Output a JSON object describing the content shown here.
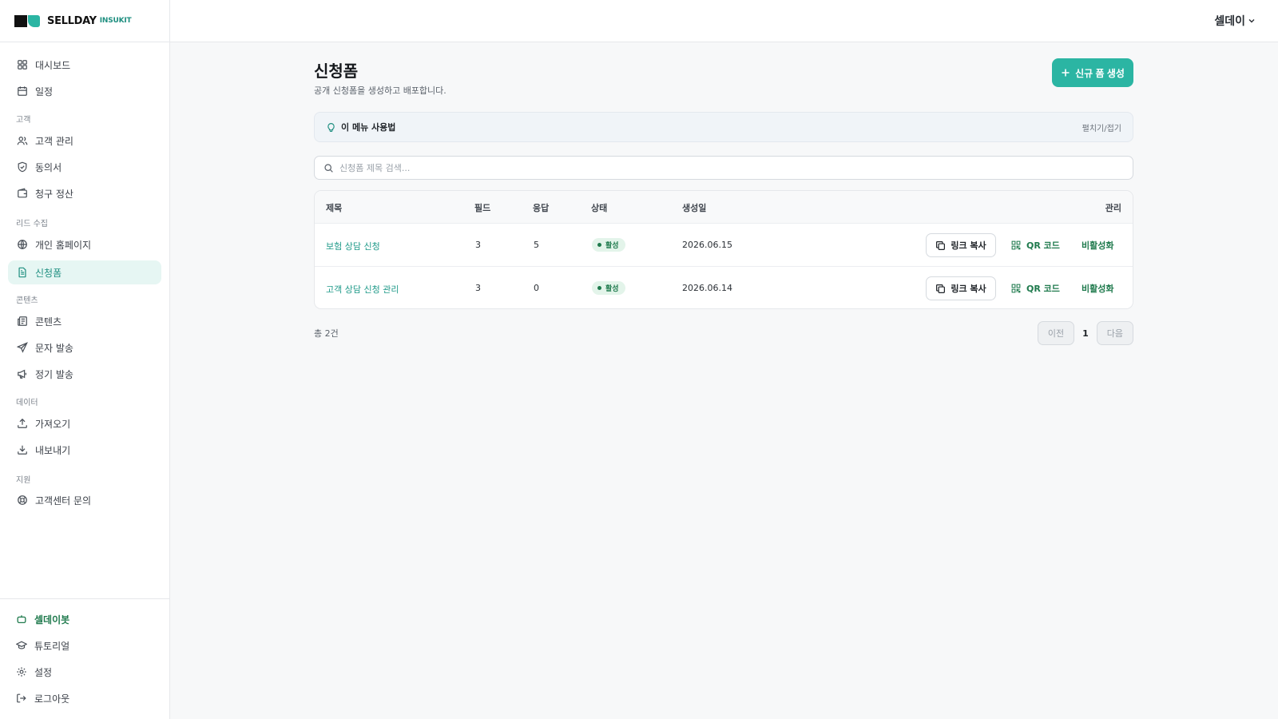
{
  "brand": {
    "name": "SELLDAY",
    "sub": "INSUKIT",
    "accent": "#2bb5a3"
  },
  "sidebar": {
    "items": [
      {
        "label": "대시보드",
        "icon": "dashboard-icon"
      },
      {
        "label": "일정",
        "icon": "calendar-icon"
      },
      {
        "label": "고객 관리",
        "icon": "users-icon"
      },
      {
        "label": "동의서",
        "icon": "shield-icon"
      },
      {
        "label": "청구 정산",
        "icon": "wallet-icon"
      },
      {
        "label": "개인 홈페이지",
        "icon": "globe-icon"
      },
      {
        "label": "신청폼",
        "icon": "form-icon",
        "active": true
      },
      {
        "label": "콘텐츠",
        "icon": "newspaper-icon"
      },
      {
        "label": "문자 발송",
        "icon": "send-icon"
      },
      {
        "label": "정기 발송",
        "icon": "megaphone-icon"
      },
      {
        "label": "가져오기",
        "icon": "upload-icon"
      },
      {
        "label": "내보내기",
        "icon": "download-icon"
      },
      {
        "label": "고객센터 문의",
        "icon": "lifebuoy-icon"
      }
    ],
    "sections": [
      "고객",
      "리드 수집",
      "콘텐츠",
      "데이터",
      "지원"
    ],
    "bottom": [
      {
        "label": "셀데이봇",
        "icon": "bot-icon"
      },
      {
        "label": "튜토리얼",
        "icon": "graduation-cap-icon"
      },
      {
        "label": "설정",
        "icon": "gear-icon"
      },
      {
        "label": "로그아웃",
        "icon": "logout-icon"
      }
    ]
  },
  "header": {
    "user": "셀데이"
  },
  "page": {
    "title": "신청폼",
    "subtitle": "공개 신청폼을 생성하고 배포합니다.",
    "create_label": "신규 폼 생성"
  },
  "help": {
    "title": "이 메뉴 사용법",
    "toggle": "펼치기/접기"
  },
  "search": {
    "placeholder": "신청폼 제목 검색..."
  },
  "table": {
    "headers": [
      "제목",
      "필드",
      "응답",
      "상태",
      "생성일",
      "관리"
    ],
    "rows": [
      {
        "title": "보험 상담 신청",
        "fields": "3",
        "responses": "5",
        "status": "활성",
        "created": "2026.06.15"
      },
      {
        "title": "고객 상담 신청 관리",
        "fields": "3",
        "responses": "0",
        "status": "활성",
        "created": "2026.06.14"
      }
    ],
    "actions": {
      "copy": "링크 복사",
      "qr": "QR 코드",
      "deactivate": "비활성화"
    }
  },
  "pagination": {
    "total": "총 2건",
    "prev": "이전",
    "page": "1",
    "next": "다음"
  }
}
